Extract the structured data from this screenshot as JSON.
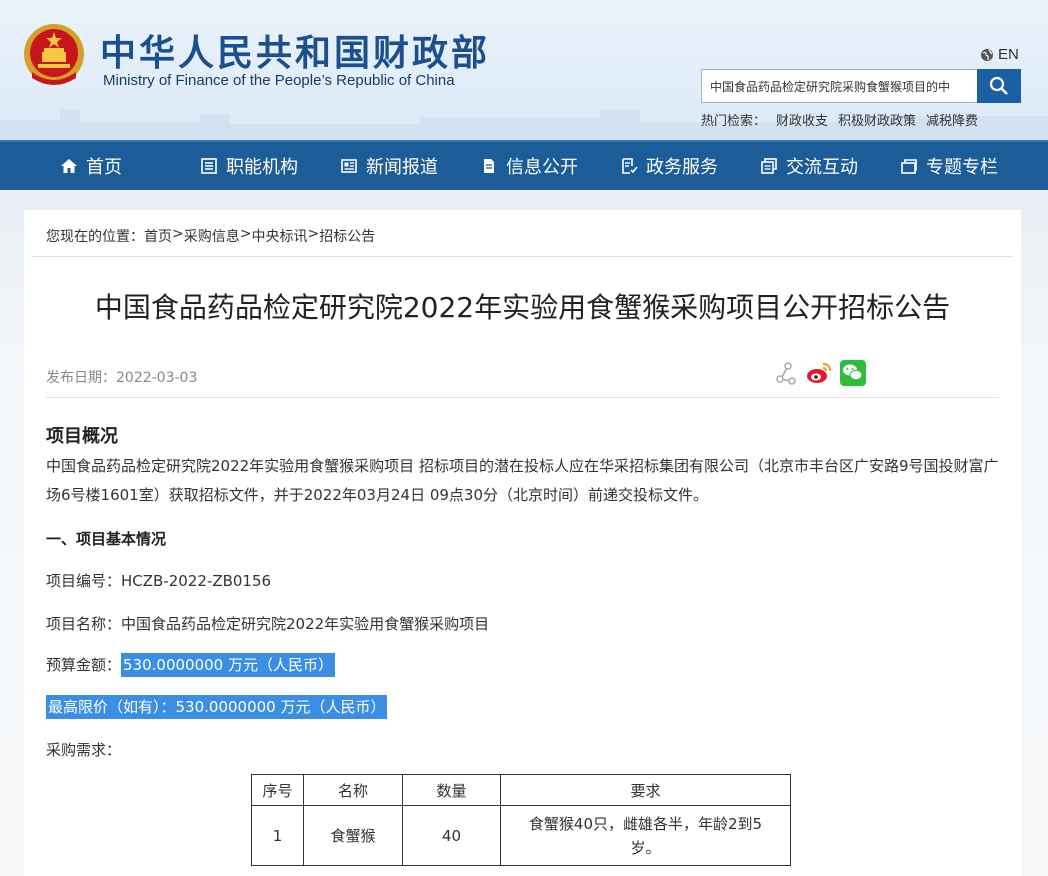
{
  "header": {
    "title": "中华人民共和国财政部",
    "subtitle": "Ministry of Finance of the People’s Republic of China",
    "lang": "EN",
    "search_value": "中国食品药品检定研究院采购食蟹猴项目的中",
    "hot_label": "热门检索：",
    "hot_items": [
      "财政收支",
      "积极财政政策",
      "减税降费"
    ]
  },
  "nav": [
    {
      "label": "首页",
      "icon": "home-icon"
    },
    {
      "label": "职能机构",
      "icon": "list-icon"
    },
    {
      "label": "新闻报道",
      "icon": "newspaper-icon"
    },
    {
      "label": "信息公开",
      "icon": "document-icon"
    },
    {
      "label": "政务服务",
      "icon": "service-icon"
    },
    {
      "label": "交流互动",
      "icon": "chat-icon"
    },
    {
      "label": "专题专栏",
      "icon": "folder-icon"
    }
  ],
  "breadcrumb": {
    "prefix": "您现在的位置：",
    "items": [
      "首页",
      "采购信息",
      "中央标讯",
      "招标公告"
    ],
    "sep": ">"
  },
  "article": {
    "title": "中国食品药品检定研究院2022年实验用食蟹猴采购项目公开招标公告",
    "pubdate": "发布日期：2022-03-03",
    "overview_title": "项目概况",
    "overview_text": "中国食品药品检定研究院2022年实验用食蟹猴采购项目 招标项目的潜在投标人应在华采招标集团有限公司（北京市丰台区广安路9号国投财富广场6号楼1601室）获取招标文件，并于2022年03月24日 09点30分（北京时间）前递交投标文件。",
    "section1_title": "一、项目基本情况",
    "project_no": "项目编号：HCZB-2022-ZB0156",
    "project_name": "项目名称：中国食品药品检定研究院2022年实验用食蟹猴采购项目",
    "budget_label": "预算金额：",
    "budget_value": "530.0000000 万元（人民币）",
    "max_price": "最高限价（如有）：530.0000000 万元（人民币）",
    "demand_label": "采购需求："
  },
  "table": {
    "headers": [
      "序号",
      "名称",
      "数量",
      "要求"
    ],
    "rows": [
      [
        "1",
        "食蟹猴",
        "40",
        "食蟹猴40只，雌雄各半，年龄2到5岁。"
      ]
    ]
  },
  "colors": {
    "nav_bg": "#1c5c99",
    "title_blue": "#1b4f8f",
    "highlight": "#3a8ee6"
  }
}
